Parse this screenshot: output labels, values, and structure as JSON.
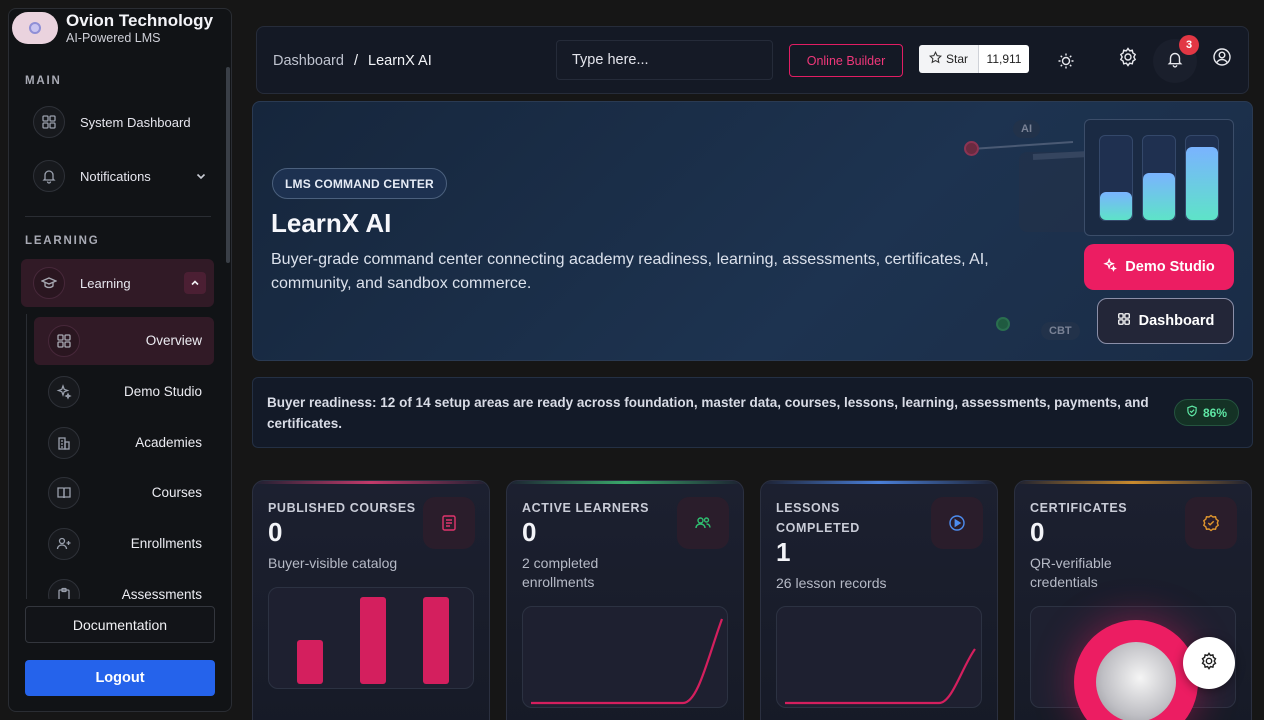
{
  "brand": {
    "name": "Ovion Technology",
    "subtitle": "AI-Powered LMS"
  },
  "sidebar": {
    "sections": {
      "main": "MAIN",
      "learning": "LEARNING"
    },
    "main_items": [
      {
        "label": "System Dashboard",
        "icon": "dashboard-grid-icon"
      },
      {
        "label": "Notifications",
        "icon": "bell-icon"
      }
    ],
    "learning_group": {
      "label": "Learning",
      "icon": "graduation-cap-icon",
      "expanded": true
    },
    "learning_items": [
      {
        "label": "Overview",
        "icon": "dashboard-grid-icon",
        "active": true
      },
      {
        "label": "Demo Studio",
        "icon": "sparkles-icon"
      },
      {
        "label": "Academies",
        "icon": "building-icon"
      },
      {
        "label": "Courses",
        "icon": "book-icon"
      },
      {
        "label": "Enrollments",
        "icon": "user-plus-icon"
      },
      {
        "label": "Assessments",
        "icon": "clipboard-icon"
      }
    ],
    "documentation_label": "Documentation",
    "logout_label": "Logout"
  },
  "header": {
    "breadcrumb": {
      "root": "Dashboard",
      "separator": "/",
      "current": "LearnX AI"
    },
    "search_placeholder": "Type here...",
    "online_builder_label": "Online Builder",
    "star_label": "Star",
    "star_count": "11,911",
    "notification_count": "3"
  },
  "hero": {
    "tag": "LMS COMMAND CENTER",
    "title": "LearnX AI",
    "description": "Buyer-grade command center connecting academy readiness, learning, assessments, certificates, AI, community, and sandbox commerce.",
    "deco_ai": "AI",
    "deco_cbt": "CBT",
    "mini_bars": [
      0.32,
      0.55,
      0.85
    ],
    "demo_button": "Demo Studio",
    "dashboard_button": "Dashboard"
  },
  "readiness": {
    "text": "Buyer readiness: 12 of 14 setup areas are ready across foundation, master data, courses, lessons, learning, assessments, payments, and certificates.",
    "percent": "86%"
  },
  "stats": [
    {
      "label": "PUBLISHED COURSES",
      "value": "0",
      "sub": "Buyer-visible catalog",
      "accent": "#c33a6b",
      "icon": "list-icon",
      "icon_color": "#e0356d",
      "bars": [
        0.47,
        0.93,
        0.93
      ]
    },
    {
      "label": "ACTIVE LEARNERS",
      "value": "0",
      "sub": "2 completed enrollments",
      "accent": "#3aa86b",
      "icon": "users-icon",
      "icon_color": "#2fbf71"
    },
    {
      "label": "LESSONS COMPLETED",
      "value": "1",
      "sub": "26 lesson records",
      "accent": "#4a7fd8",
      "icon": "play-circle-icon",
      "icon_color": "#4d8df0"
    },
    {
      "label": "CERTIFICATES",
      "value": "0",
      "sub": "QR-verifiable credentials",
      "accent": "#c98a2e",
      "icon": "badge-check-icon",
      "icon_color": "#e0962e"
    }
  ],
  "colors": {
    "accent_pink": "#ec1d62",
    "logout_blue": "#2563eb",
    "ready_green": "#5ee6a4"
  }
}
